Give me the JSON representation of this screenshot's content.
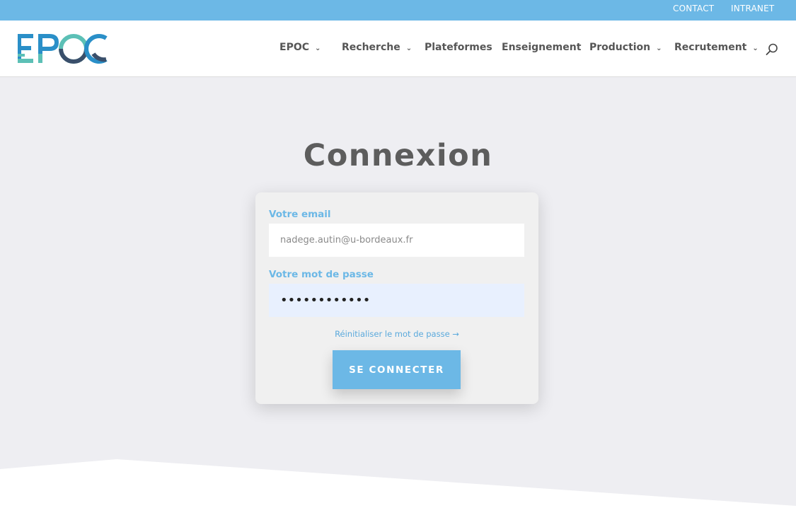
{
  "topbar": {
    "contact": "CONTACT",
    "intranet": "INTRANET"
  },
  "logo": {
    "text": "EPOC"
  },
  "nav": {
    "items": [
      {
        "label": "EPOC",
        "has_dropdown": true
      },
      {
        "label": "Recherche",
        "has_dropdown": true
      },
      {
        "label": "Plateformes",
        "has_dropdown": false
      },
      {
        "label": "Enseignement",
        "has_dropdown": false
      },
      {
        "label": "Production",
        "has_dropdown": true
      },
      {
        "label": "Recrutement",
        "has_dropdown": true
      }
    ],
    "chevron": "⌄",
    "search_icon": "search-icon"
  },
  "page": {
    "title": "Connexion"
  },
  "form": {
    "email_label": "Votre email",
    "email_value": "nadege.autin@u-bordeaux.fr",
    "password_label": "Votre mot de passe",
    "password_value": "••••••••••••",
    "reset_link": "Réinitialiser le mot de passe →",
    "submit_label": "SE CONNECTER"
  },
  "colors": {
    "accent": "#6cb8e6",
    "title": "#5d5d5d",
    "background": "#eeeef2",
    "autofill": "#e8f0fe"
  }
}
